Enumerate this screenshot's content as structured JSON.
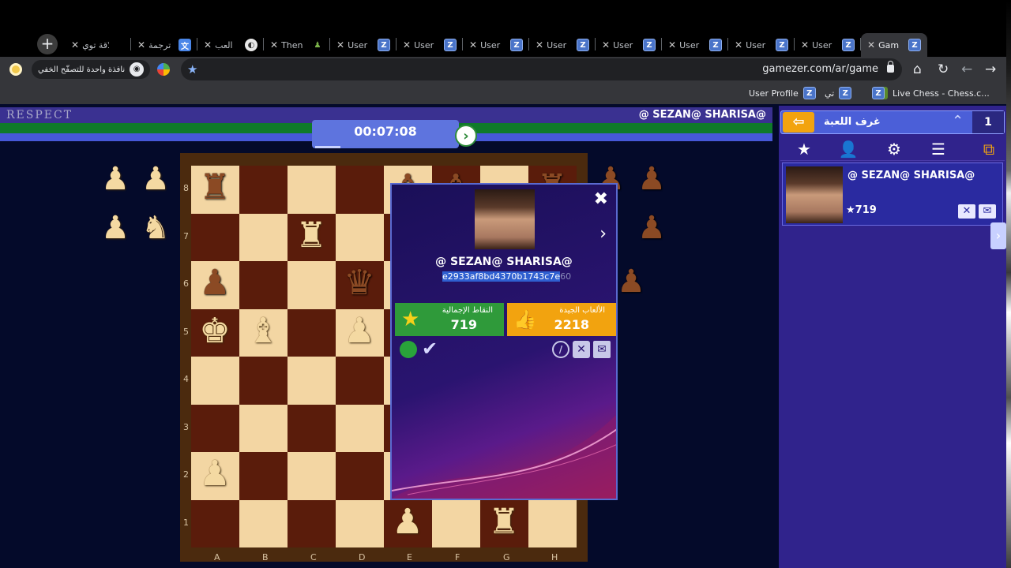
{
  "browser": {
    "tabs": [
      {
        "label": "علاقة توي",
        "icon": "heart-icon"
      },
      {
        "label": "ترجمة",
        "icon": "translate-icon"
      },
      {
        "label": "العب",
        "icon": "chess-com-icon"
      },
      {
        "label": "Then",
        "icon": "pawn-icon"
      },
      {
        "label": "User",
        "icon": "gamezer-icon"
      },
      {
        "label": "User",
        "icon": "gamezer-icon"
      },
      {
        "label": "User",
        "icon": "gamezer-icon"
      },
      {
        "label": "User",
        "icon": "gamezer-icon"
      },
      {
        "label": "User",
        "icon": "gamezer-icon"
      },
      {
        "label": "User",
        "icon": "gamezer-icon"
      },
      {
        "label": "User",
        "icon": "gamezer-icon"
      },
      {
        "label": "User",
        "icon": "gamezer-icon"
      },
      {
        "label": "Gam",
        "icon": "gamezer-icon",
        "active": true
      }
    ],
    "new_tab": "+",
    "url": "gamezer.com/ar/game",
    "incognito_label": "نافذة واحدة للتصفّح الخفي",
    "bookmarks": [
      {
        "label": "User Profile",
        "icon": "gamezer-icon"
      },
      {
        "label": "تي",
        "icon": "gamezer-icon"
      },
      {
        "label": "",
        "icon": "gamezer-icon"
      },
      {
        "label": "Live Chess - Chess.c...",
        "icon": "pawn-icon"
      }
    ]
  },
  "game": {
    "my_name": "RESPECT",
    "opponent_name": "@ SEZAN@ SHARISA@",
    "timer": "00:07:08",
    "timer_progress": 0.17,
    "ranks": [
      "8",
      "7",
      "6",
      "5",
      "4",
      "3",
      "2",
      "1"
    ],
    "files": [
      "A",
      "B",
      "C",
      "D",
      "E",
      "F",
      "G",
      "H"
    ]
  },
  "popup": {
    "name": "@ SEZAN@ SHARISA@",
    "id_selected": "e2933af8bd4370b1743c7e",
    "id_rest": "60",
    "total_points_label": "النقاط الإجمالية",
    "total_points": "719",
    "good_games_label": "الألعاب الجيدة",
    "good_games": "2218",
    "status": "online"
  },
  "rooms": {
    "title": "غرف اللعبة",
    "count": "1",
    "player": {
      "name": "@ SEZAN@ SHARISA@",
      "points": "★719"
    }
  },
  "colors": {
    "panel": "#30238c",
    "green": "#2f9a3a",
    "orange": "#f2a30f",
    "board_light": "#f3d6a3",
    "board_dark": "#5a1c0b"
  }
}
